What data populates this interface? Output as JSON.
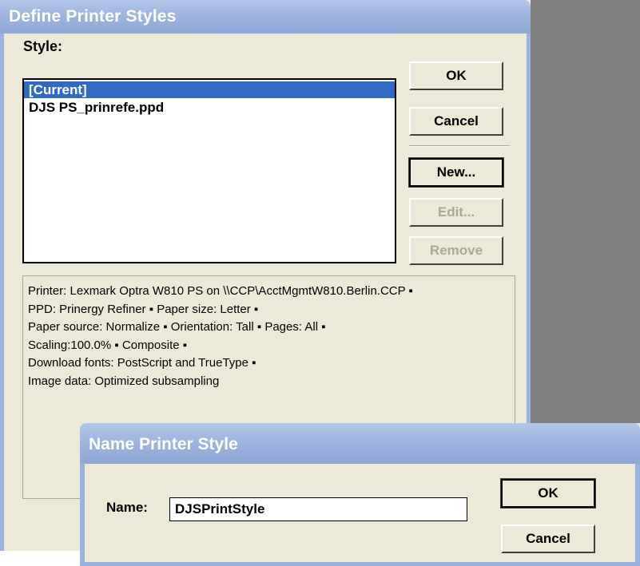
{
  "main_dialog": {
    "title": "Define Printer Styles",
    "style_label": "Style:",
    "styles": [
      "[Current]",
      "DJS PS_prinrefe.ppd"
    ],
    "buttons": {
      "ok": "OK",
      "cancel": "Cancel",
      "new": "New...",
      "edit": "Edit...",
      "remove": "Remove"
    },
    "info_lines": [
      "Printer: Lexmark Optra W810 PS on \\\\CCP\\AcctMgmtW810.Berlin.CCP ▪",
      "PPD: Prinergy Refiner ▪ Paper size: Letter ▪",
      "Paper source: Normalize ▪ Orientation: Tall ▪ Pages: All ▪",
      "Scaling:100.0% ▪ Composite ▪",
      "Download fonts: PostScript and TrueType ▪",
      "Image data: Optimized subsampling"
    ]
  },
  "name_dialog": {
    "title": "Name Printer Style",
    "name_label": "Name:",
    "name_value": "DJSPrintStyle",
    "buttons": {
      "ok": "OK",
      "cancel": "Cancel"
    }
  },
  "colors": {
    "titlebar": "#9cb2de",
    "dialog_bg": "#ece9d8",
    "selection": "#316ac5",
    "desktop": "#808080"
  }
}
